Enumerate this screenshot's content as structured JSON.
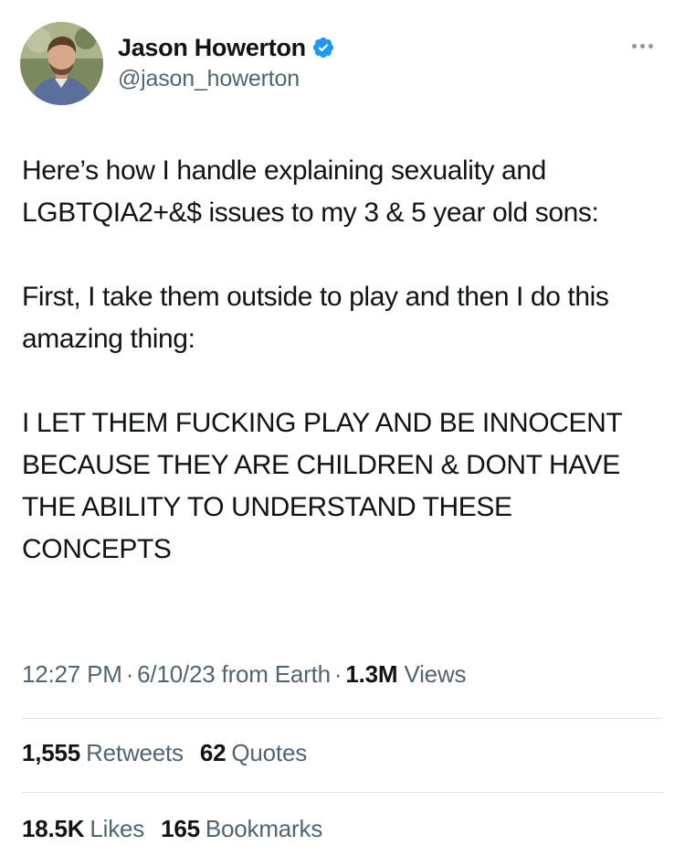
{
  "author": {
    "display_name": "Jason Howerton",
    "handle": "@jason_howerton",
    "verified": true
  },
  "tweet": {
    "paragraphs": [
      "Here’s how I handle explaining sexuality and LGBTQIA2+&$ issues to my 3 & 5 year old sons:",
      "First, I take them outside to play and then I do this amazing thing:",
      "I LET THEM FUCKING PLAY AND BE INNOCENT BECAUSE THEY ARE CHILDREN & DONT HAVE THE ABILITY TO UNDERSTAND THESE CONCEPTS"
    ]
  },
  "meta": {
    "time": "12:27 PM",
    "separator": "·",
    "date": "6/10/23",
    "source": "from Earth",
    "views_count": "1.3M",
    "views_label": "Views"
  },
  "stats": {
    "retweets_count": "1,555",
    "retweets_label": "Retweets",
    "quotes_count": "62",
    "quotes_label": "Quotes",
    "likes_count": "18.5K",
    "likes_label": "Likes",
    "bookmarks_count": "165",
    "bookmarks_label": "Bookmarks"
  },
  "colors": {
    "verified_blue": "#1d9bf0",
    "secondary_text": "#536471",
    "primary_text": "#0f1419",
    "divider": "#dfe3e6"
  },
  "icons": {
    "verified": "verified-badge-icon",
    "more": "more-options-icon"
  }
}
